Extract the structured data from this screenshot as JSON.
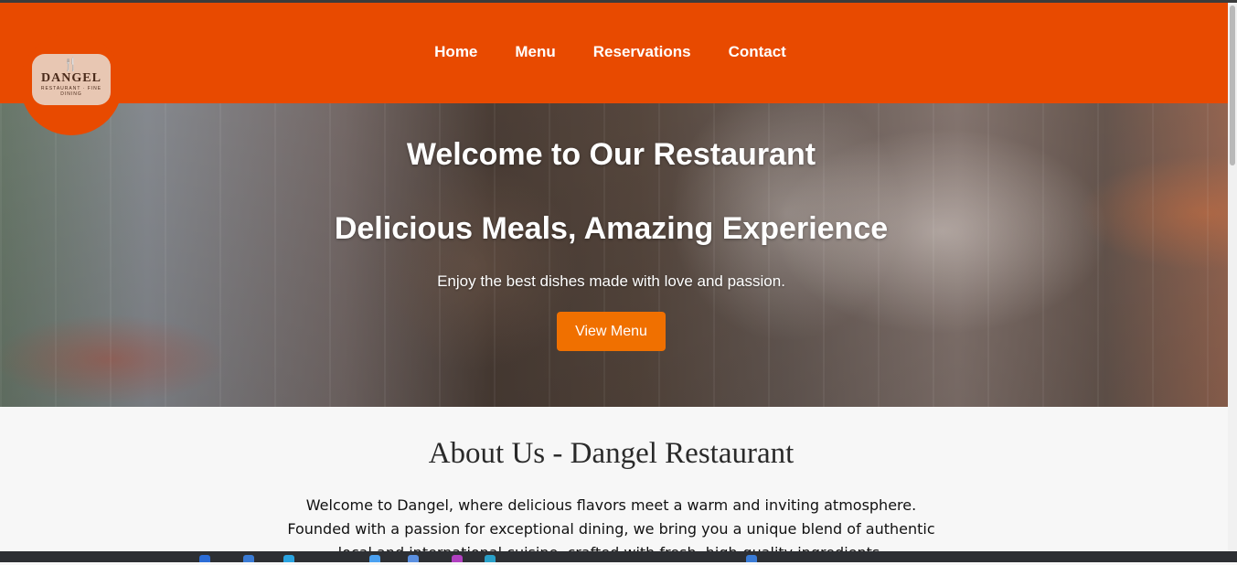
{
  "logo": {
    "name": "DANGEL",
    "sub": "RESTAURANT · FINE DINING"
  },
  "nav": {
    "items": [
      "Home",
      "Menu",
      "Reservations",
      "Contact"
    ]
  },
  "hero": {
    "title": "Welcome to Our Restaurant",
    "subtitle": "Delicious Meals, Amazing Experience",
    "tagline": "Enjoy the best dishes made with love and passion.",
    "button": "View Menu"
  },
  "about": {
    "heading": "About Us - Dangel Restaurant",
    "line1": "Welcome to Dangel, where delicious flavors meet a warm and inviting atmosphere.",
    "line2": "Founded with a passion for exceptional dining, we bring you a unique blend of authentic",
    "line3": "local and international cuisine, crafted with fresh, high-quality ingredients."
  },
  "colors": {
    "header": "#e84a00",
    "button": "#f07000",
    "background": "#f7f7f7"
  }
}
